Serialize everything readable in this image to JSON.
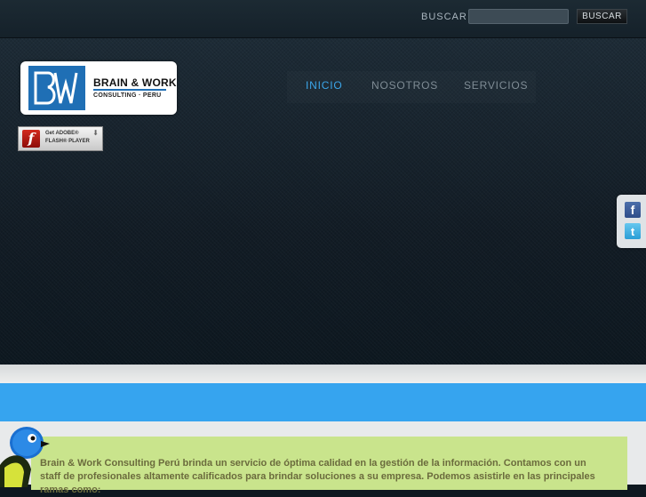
{
  "header": {
    "search_label": "BUSCAR",
    "search_value": "",
    "search_button": "BUSCAR"
  },
  "logo": {
    "line1": "BRAIN & WORK",
    "line2": "CONSULTING · PERU",
    "mark": "BW",
    "accent": "#1f6fb5"
  },
  "flash": {
    "line1": "Get ADOBE®",
    "line2": "FLASH® PLAYER",
    "glyph": "f"
  },
  "nav": {
    "items": [
      {
        "label": "INICIO",
        "active": true
      },
      {
        "label": "NOSOTROS",
        "active": false
      },
      {
        "label": "SERVICIOS",
        "active": false
      }
    ],
    "active_color": "#3ba6ea"
  },
  "social": {
    "facebook": "f",
    "twitter": "t"
  },
  "content": {
    "intro": "Brain & Work Consulting Perú brinda un servicio de óptima calidad en la gestión de la información. Contamos con un staff de profesionales altamente calificados para brindar soluciones a su empresa. Podemos asistirle en las principales ramas como:"
  },
  "colors": {
    "blue_bar": "#36a4ef",
    "green_box": "#c9e48c"
  }
}
